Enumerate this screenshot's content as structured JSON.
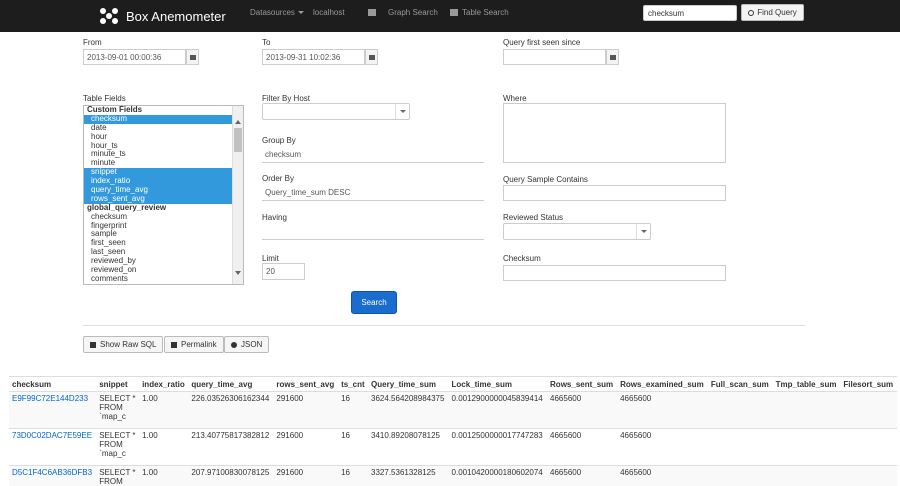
{
  "navbar": {
    "brand": "Box Anemometer",
    "datasources": "Datasources",
    "host": "localhost",
    "graph_search": "Graph Search",
    "table_search": "Table Search",
    "search_value": "checksum",
    "find_query": "Find Query"
  },
  "form": {
    "from_label": "From",
    "from_value": "2013-09-01 00:00:36",
    "to_label": "To",
    "to_value": "2013-09-31 10:02:36",
    "first_seen_label": "Query first seen since",
    "first_seen_value": "",
    "table_fields_label": "Table Fields",
    "filter_host_label": "Filter By Host",
    "group_by_label": "Group By",
    "group_by_value": "checksum",
    "order_by_label": "Order By",
    "order_by_value": "Query_time_sum DESC",
    "having_label": "Having",
    "having_value": "",
    "limit_label": "Limit",
    "limit_value": "20",
    "where_label": "Where",
    "sample_contains_label": "Query Sample Contains",
    "reviewed_status_label": "Reviewed Status",
    "checksum_label": "Checksum",
    "search_button": "Search"
  },
  "fields": [
    {
      "label": "Custom Fields",
      "group": true,
      "selected": false
    },
    {
      "label": "checksum",
      "group": false,
      "selected": true
    },
    {
      "label": "date",
      "group": false,
      "selected": false
    },
    {
      "label": "hour",
      "group": false,
      "selected": false
    },
    {
      "label": "hour_ts",
      "group": false,
      "selected": false
    },
    {
      "label": "minute_ts",
      "group": false,
      "selected": false
    },
    {
      "label": "minute",
      "group": false,
      "selected": false
    },
    {
      "label": "snippet",
      "group": false,
      "selected": true
    },
    {
      "label": "index_ratio",
      "group": false,
      "selected": true
    },
    {
      "label": "query_time_avg",
      "group": false,
      "selected": true
    },
    {
      "label": "rows_sent_avg",
      "group": false,
      "selected": true
    },
    {
      "label": "global_query_review",
      "group": true,
      "selected": false
    },
    {
      "label": "checksum",
      "group": false,
      "selected": false
    },
    {
      "label": "fingerprint",
      "group": false,
      "selected": false
    },
    {
      "label": "sample",
      "group": false,
      "selected": false
    },
    {
      "label": "first_seen",
      "group": false,
      "selected": false
    },
    {
      "label": "last_seen",
      "group": false,
      "selected": false
    },
    {
      "label": "reviewed_by",
      "group": false,
      "selected": false
    },
    {
      "label": "reviewed_on",
      "group": false,
      "selected": false
    },
    {
      "label": "comments",
      "group": false,
      "selected": false
    }
  ],
  "toolbar": {
    "show_raw_sql": "Show Raw SQL",
    "permalink": "Permalink",
    "json": "JSON"
  },
  "table": {
    "headers": [
      "checksum",
      "snippet",
      "index_ratio",
      "query_time_avg",
      "rows_sent_avg",
      "ts_cnt",
      "Query_time_sum",
      "Lock_time_sum",
      "Rows_sent_sum",
      "Rows_examined_sum",
      "Full_scan_sum",
      "Tmp_table_sum",
      "Filesort_sum"
    ],
    "rows": [
      [
        "E9F99C72E144D233",
        "SELECT *\nFROM\n`map_c",
        "1.00",
        "226.03526306162344",
        "291600",
        "16",
        "3624.564208984375",
        "0.0012900000045839414",
        "4665600",
        "4665600",
        "",
        "",
        ""
      ],
      [
        "73D0C02DAC7E59EE",
        "SELECT *\nFROM\n`map_c",
        "1.00",
        "213.40775817382812",
        "291600",
        "16",
        "3410.89208078125",
        "0.0012500000017747283",
        "4665600",
        "4665600",
        "",
        "",
        ""
      ],
      [
        "D5C1F4C6AB36DFB3",
        "SELECT *\nFROM",
        "1.00",
        "207.97100830078125",
        "291600",
        "16",
        "3327.5361328125",
        "0.0010420000180602074",
        "4665600",
        "4665600",
        "",
        "",
        ""
      ]
    ]
  }
}
